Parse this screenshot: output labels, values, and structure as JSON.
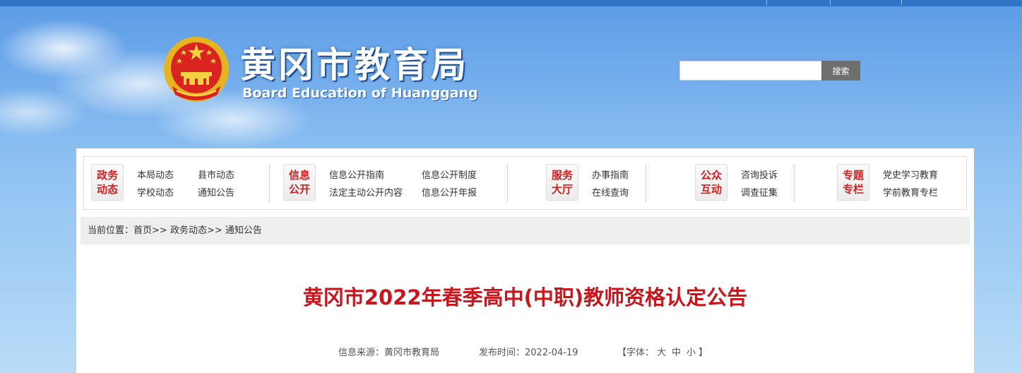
{
  "header": {
    "title": "黄冈市教育局",
    "subtitle": "Board Education of Huanggang",
    "emblem_icon": "national-emblem-icon",
    "search": {
      "value": "",
      "placeholder": "",
      "button_label": "搜索"
    },
    "colors": {
      "topbar": "#2f73c9",
      "title_red": "#c8161d",
      "badge_red": "#d42020"
    }
  },
  "nav": {
    "groups": [
      {
        "badge": [
          "政务",
          "动态"
        ],
        "links": [
          "本局动态",
          "县市动态",
          "学校动态",
          "通知公告"
        ]
      },
      {
        "badge": [
          "信息",
          "公开"
        ],
        "links": [
          "信息公开指南",
          "信息公开制度",
          "法定主动公开内容",
          "信息公开年报"
        ]
      },
      {
        "badge": [
          "服务",
          "大厅"
        ],
        "links": [
          "办事指南",
          "在线查询"
        ]
      },
      {
        "badge": [
          "公众",
          "互动"
        ],
        "links": [
          "咨询投诉",
          "调查征集"
        ]
      },
      {
        "badge": [
          "专题",
          "专栏"
        ],
        "links": [
          "党史学习教育",
          "学前教育专栏"
        ]
      }
    ]
  },
  "breadcrumb": {
    "label": "当前位置：",
    "items": [
      "首页",
      "政务动态",
      "通知公告"
    ],
    "separator": ">>"
  },
  "article": {
    "title": "黄冈市2022年春季高中(中职)教师资格认定公告",
    "source_label": "信息来源：",
    "source": "黄冈市教育局",
    "date_label": "发布时间：",
    "date": "2022-04-19",
    "font_size_label": "【字体：",
    "font_sizes": [
      "大",
      "中",
      "小"
    ],
    "font_size_close": "】"
  }
}
